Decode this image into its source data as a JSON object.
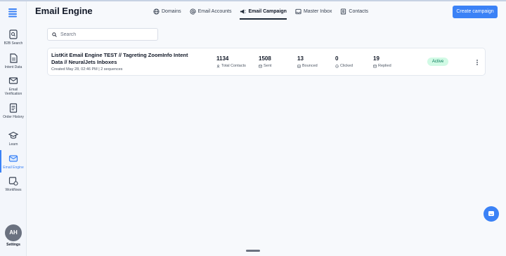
{
  "header": {
    "title": "Email Engine",
    "create_button": "Create campaign"
  },
  "tabs": [
    {
      "label": "Domains",
      "icon": "globe-icon"
    },
    {
      "label": "Email Accounts",
      "icon": "at-icon"
    },
    {
      "label": "Email Campaign",
      "icon": "megaphone-icon",
      "active": true
    },
    {
      "label": "Master Inbox",
      "icon": "inbox-icon"
    },
    {
      "label": "Contacts",
      "icon": "contacts-icon"
    }
  ],
  "sidebar": {
    "items": [
      {
        "label": "B2B Search",
        "icon": "b2b-search-icon"
      },
      {
        "label": "Intent Data",
        "icon": "document-icon"
      },
      {
        "label": "Email Verification",
        "icon": "mail-check-icon"
      },
      {
        "label": "Order History",
        "icon": "order-history-icon"
      },
      {
        "label": "Learn",
        "icon": "graduation-cap-icon"
      },
      {
        "label": "Email Engine",
        "icon": "email-engine-icon",
        "active": true
      },
      {
        "label": "Workflows",
        "icon": "workflow-icon"
      }
    ],
    "avatar_initials": "AH",
    "settings_label": "Settings"
  },
  "search": {
    "placeholder": "Search",
    "value": ""
  },
  "campaign": {
    "title": "ListKit Email Engine TEST // Tagreting ZoomInfo Intent Data // NeuralJets Inboxes",
    "meta": "Created May 28, 02:46 PM | 2 sequences",
    "stats": [
      {
        "value": "1134",
        "label": "Total Contacts",
        "icon": "contacts-icon"
      },
      {
        "value": "1508",
        "label": "Sent",
        "icon": "sent-icon"
      },
      {
        "value": "13",
        "label": "Bounced",
        "icon": "bounced-icon"
      },
      {
        "value": "0",
        "label": "Clicked",
        "icon": "clicked-icon"
      },
      {
        "value": "19",
        "label": "Replied",
        "icon": "replied-icon"
      }
    ],
    "status": "Active"
  },
  "colors": {
    "accent": "#3b82f6",
    "status_bg": "#d1fae5",
    "status_text": "#047857"
  }
}
